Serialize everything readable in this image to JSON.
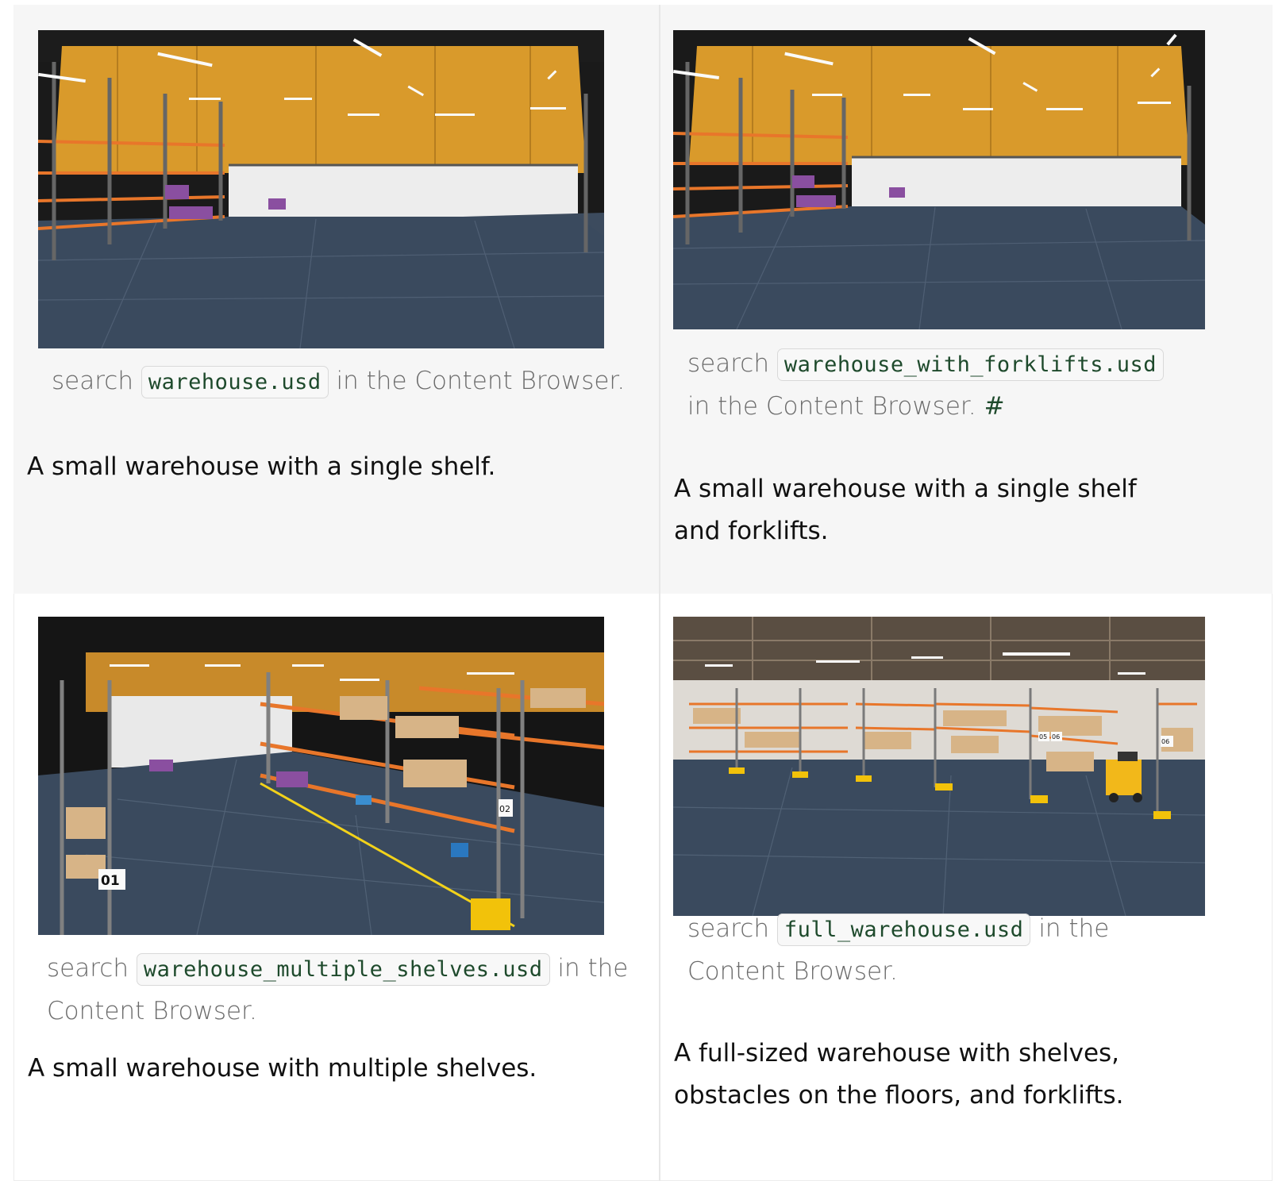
{
  "cards": [
    {
      "image_alt": "Empty small warehouse interior with a single shelf",
      "search_prefix": "search",
      "file": "warehouse.usd",
      "search_suffix": "in the Content Browser.",
      "caption": "A small warehouse with a single shelf."
    },
    {
      "image_alt": "Small warehouse interior with a single shelf",
      "search_prefix": "search",
      "file": "warehouse_with_forklifts.usd",
      "search_suffix": "in the Content Browser.",
      "anchor": "#",
      "caption": "A small warehouse with a single shelf and forklifts."
    },
    {
      "image_alt": "Small warehouse with multiple shelving racks",
      "search_prefix": "search",
      "file": "warehouse_multiple_shelves.usd",
      "search_suffix": "in the Content Browser.",
      "caption": "A small warehouse with multiple shelves.",
      "rack_labels": [
        "01",
        "02"
      ]
    },
    {
      "image_alt": "Full-sized warehouse with many shelves and a forklift",
      "search_prefix": "search",
      "file": "full_warehouse.usd",
      "search_suffix": "in the Content Browser.",
      "caption": "A full-sized warehouse with shelves, obstacles on the floors, and forklifts.",
      "rack_labels": [
        "05",
        "06",
        "06"
      ]
    }
  ],
  "colors": {
    "wall_orange": "#d99a2b",
    "floor": "#3a4a5e",
    "rack_orange": "#e8762a",
    "code_text": "#1e4a2c"
  }
}
